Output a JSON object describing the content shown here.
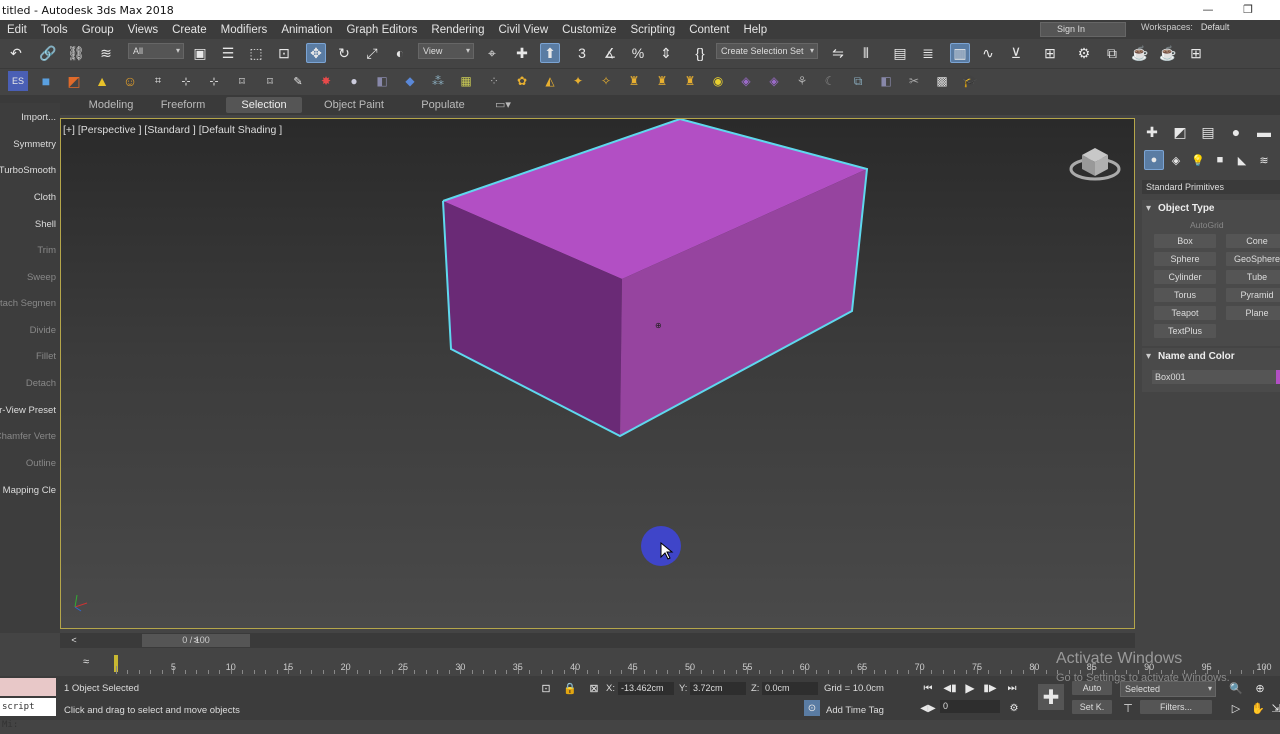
{
  "window": {
    "title": "titled - Autodesk 3ds Max 2018"
  },
  "menu": [
    "Edit",
    "Tools",
    "Group",
    "Views",
    "Create",
    "Modifiers",
    "Animation",
    "Graph Editors",
    "Rendering",
    "Civil View",
    "Customize",
    "Scripting",
    "Content",
    "Help"
  ],
  "account": {
    "signin": "Sign In",
    "workspaces_label": "Workspaces:",
    "workspace": "Default"
  },
  "toolbar": {
    "filter": "All",
    "refcoord": "View",
    "selection_set": "Create Selection Set"
  },
  "ribbon": {
    "tabs": [
      "Modeling",
      "Freeform",
      "Selection",
      "Object Paint",
      "Populate"
    ],
    "active": "Selection"
  },
  "left_panel": [
    "Import...",
    "Symmetry",
    "TurboSmooth",
    "Cloth",
    "Shell",
    "Trim",
    "Sweep",
    "etach Segmen",
    "Divide",
    "Fillet",
    "Detach",
    "er-View Preset",
    "Chamfer Verte",
    "Outline",
    "W Mapping Cle"
  ],
  "viewport": {
    "label": "[+] [Perspective ] [Standard ] [Default Shading ]",
    "box_color": "#b24fc4"
  },
  "command_panel": {
    "category": "Standard Primitives",
    "object_type_title": "Object Type",
    "autogrid": "AutoGrid",
    "buttons": [
      "Box",
      "Cone",
      "Sphere",
      "GeoSphere",
      "Cylinder",
      "Tube",
      "Torus",
      "Pyramid",
      "Teapot",
      "Plane",
      "TextPlus"
    ],
    "name_color_title": "Name and Color",
    "object_name": "Box001"
  },
  "timeline": {
    "frame": "0 / 100",
    "ticks": [
      "5",
      "10",
      "15",
      "20",
      "25",
      "30",
      "35",
      "40",
      "45",
      "50",
      "55",
      "60",
      "65",
      "70",
      "75",
      "80",
      "85",
      "90",
      "95",
      "100"
    ]
  },
  "status": {
    "script": "script Mi:",
    "selected": "1 Object Selected",
    "prompt": "Click and drag to select and move objects",
    "x_label": "X:",
    "x": "-13.462cm",
    "y_label": "Y:",
    "y": "3.72cm",
    "z_label": "Z:",
    "z": "0.0cm",
    "grid": "Grid = 10.0cm",
    "add_time_tag": "Add Time Tag",
    "auto": "Auto",
    "selected_dd": "Selected",
    "setk": "Set K.",
    "filters": "Filters...",
    "frame_field": "0"
  },
  "watermark": {
    "line1": "Activate Windows",
    "line2": "Go to Settings to activate Windows."
  }
}
